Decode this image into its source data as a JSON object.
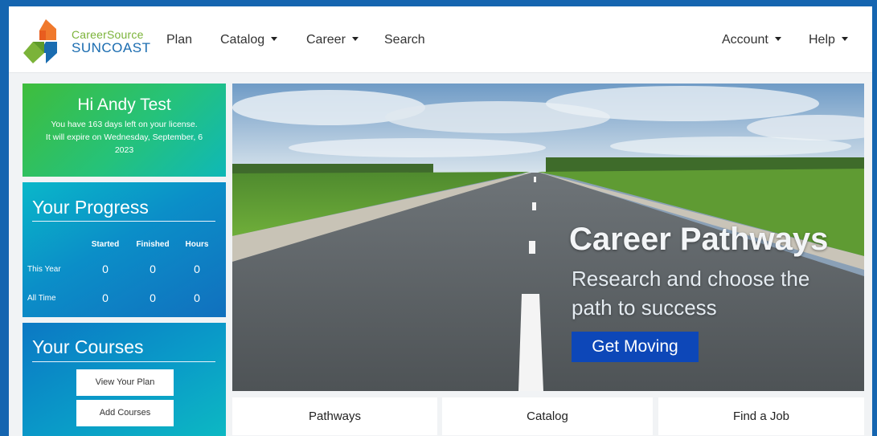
{
  "brand": {
    "line1": "CareerSource",
    "line2": "SUNCOAST",
    "colors": {
      "green": "#7bb339",
      "blue": "#1a6cb0",
      "orange": "#f0792c"
    }
  },
  "nav": {
    "plan": "Plan",
    "catalog": "Catalog",
    "career": "Career",
    "search": "Search",
    "account": "Account",
    "help": "Help"
  },
  "welcome": {
    "greeting": "Hi Andy Test",
    "line1": "You have 163 days left on your license.",
    "line2": "It will expire on Wednesday, September, 6",
    "line3": "2023"
  },
  "progress": {
    "title": "Your Progress",
    "columns": [
      "Started",
      "Finished",
      "Hours"
    ],
    "rows": [
      {
        "label": "This Year",
        "values": [
          "0",
          "0",
          "0"
        ]
      },
      {
        "label": "All Time",
        "values": [
          "0",
          "0",
          "0"
        ]
      }
    ]
  },
  "courses": {
    "title": "Your Courses",
    "view_plan": "View Your Plan",
    "add_courses": "Add Courses"
  },
  "hero": {
    "title": "Career Pathways",
    "subtitle_line1": "Research and choose the",
    "subtitle_line2": "path to success",
    "button": "Get Moving"
  },
  "tiles": {
    "pathways": "Pathways",
    "catalog": "Catalog",
    "find_job": "Find a Job"
  },
  "icons": {
    "dropdown": "caret-down-icon",
    "logo": "careersource-logo"
  }
}
